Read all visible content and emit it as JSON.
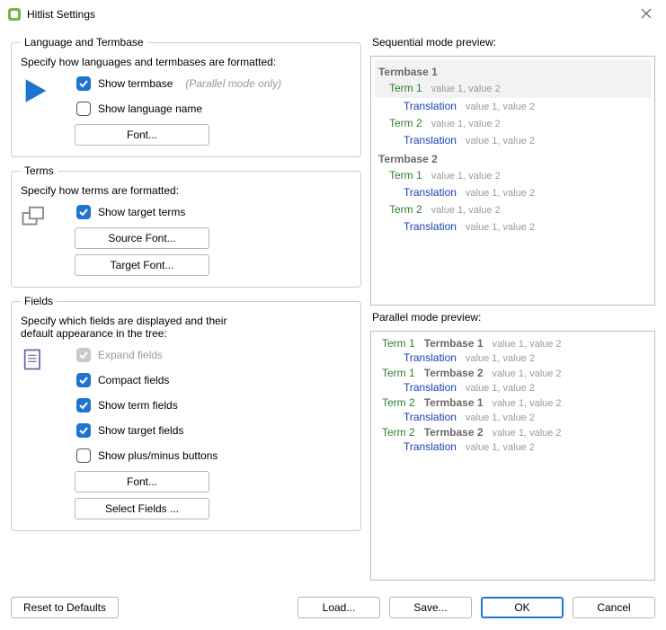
{
  "window": {
    "title": "Hitlist Settings"
  },
  "lang": {
    "legend": "Language and Termbase",
    "desc": "Specify how languages and termbases are formatted:",
    "show_termbase": "Show termbase",
    "parallel_hint": "(Parallel mode only)",
    "show_language": "Show language name",
    "font_btn": "Font..."
  },
  "terms": {
    "legend": "Terms",
    "desc": "Specify how terms are formatted:",
    "show_target": "Show target terms",
    "source_font": "Source Font...",
    "target_font": "Target Font..."
  },
  "fields": {
    "legend": "Fields",
    "desc": "Specify which fields are displayed and their default appearance in the tree:",
    "expand": "Expand fields",
    "compact": "Compact fields",
    "show_term": "Show term fields",
    "show_target": "Show target fields",
    "show_plus": "Show plus/minus buttons",
    "font_btn": "Font...",
    "select_btn": "Select Fields ..."
  },
  "seq": {
    "label": "Sequential mode preview:",
    "tb1": "Termbase 1",
    "tb2": "Termbase 2",
    "t1": "Term 1",
    "t2": "Term 2",
    "trans": "Translation",
    "vals": "value 1, value 2"
  },
  "par": {
    "label": "Parallel mode preview:",
    "t1": "Term 1",
    "t2": "Term 2",
    "tb1": "Termbase 1",
    "tb2": "Termbase 2",
    "trans": "Translation",
    "vals": "value 1, value 2"
  },
  "buttons": {
    "reset": "Reset to Defaults",
    "load": "Load...",
    "save": "Save...",
    "ok": "OK",
    "cancel": "Cancel"
  }
}
